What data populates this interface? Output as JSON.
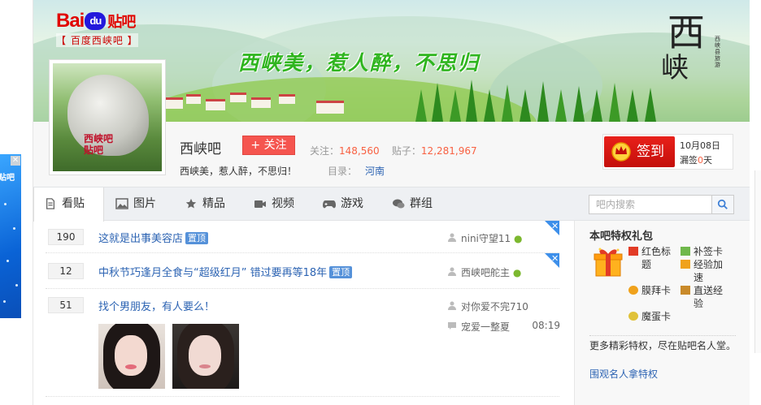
{
  "logo": {
    "brand_bai": "Bai",
    "brand_du": "du",
    "brand_tieba": "贴吧",
    "forum_sub": "【 百度西峡吧 】"
  },
  "banner": {
    "slogan": "西峡美，惹人醉，不思归",
    "seal_big": "西",
    "seal_big2": "峡",
    "seal_vertical": "西峡县旅游"
  },
  "avatar": {
    "text_line1": "西峡吧",
    "text_line2": "贴吧"
  },
  "forum": {
    "name": "西峡吧",
    "follow_label": "+ 关注",
    "follow_count_label": "关注：",
    "follow_count": "148,560",
    "post_count_label": "贴子：",
    "post_count": "12,281,967",
    "slogan": "西峡美，惹人醉，不思归！",
    "category_label": "目录：",
    "category": "河南"
  },
  "sign": {
    "button_label": "签到",
    "date": "10月08日",
    "missed_prefix": "漏签",
    "missed_days": "0",
    "missed_suffix": "天"
  },
  "tabs": [
    {
      "label": "看贴",
      "icon": "document-icon"
    },
    {
      "label": "图片",
      "icon": "image-icon"
    },
    {
      "label": "精品",
      "icon": "star-icon"
    },
    {
      "label": "视频",
      "icon": "video-icon"
    },
    {
      "label": "游戏",
      "icon": "gamepad-icon"
    },
    {
      "label": "群组",
      "icon": "chat-icon"
    }
  ],
  "search": {
    "placeholder": "吧内搜索"
  },
  "threads": [
    {
      "replies": "190",
      "title": "这就是出事美容店",
      "badge": "置顶",
      "author": "nini守望11",
      "pinned": true
    },
    {
      "replies": "12",
      "title": "中秋节巧逢月全食与“超级红月” 错过要再等18年",
      "badge": "置顶",
      "author": "西峡吧舵主",
      "pinned": true
    },
    {
      "replies": "51",
      "title": "找个男朋友，有人要么！",
      "badge": "",
      "author": "对你爱不完710",
      "last_reply": "宠爱一整夏",
      "time": "08:19",
      "pinned": false
    }
  ],
  "sidebar": {
    "title": "本吧特权礼包",
    "privileges": [
      "红色标题",
      "补签卡",
      "经验加速",
      "膜拜卡",
      "直送经验",
      "魔蛋卡"
    ],
    "desc": "更多精彩特权，尽在贴吧名人堂。",
    "link": "围观名人拿特权"
  },
  "side_ad": {
    "text": "贴吧"
  },
  "colors": {
    "accent_red": "#e10601",
    "link_blue": "#2d64b3",
    "count_orange": "#f86142",
    "badge_blue": "#5591d9"
  }
}
